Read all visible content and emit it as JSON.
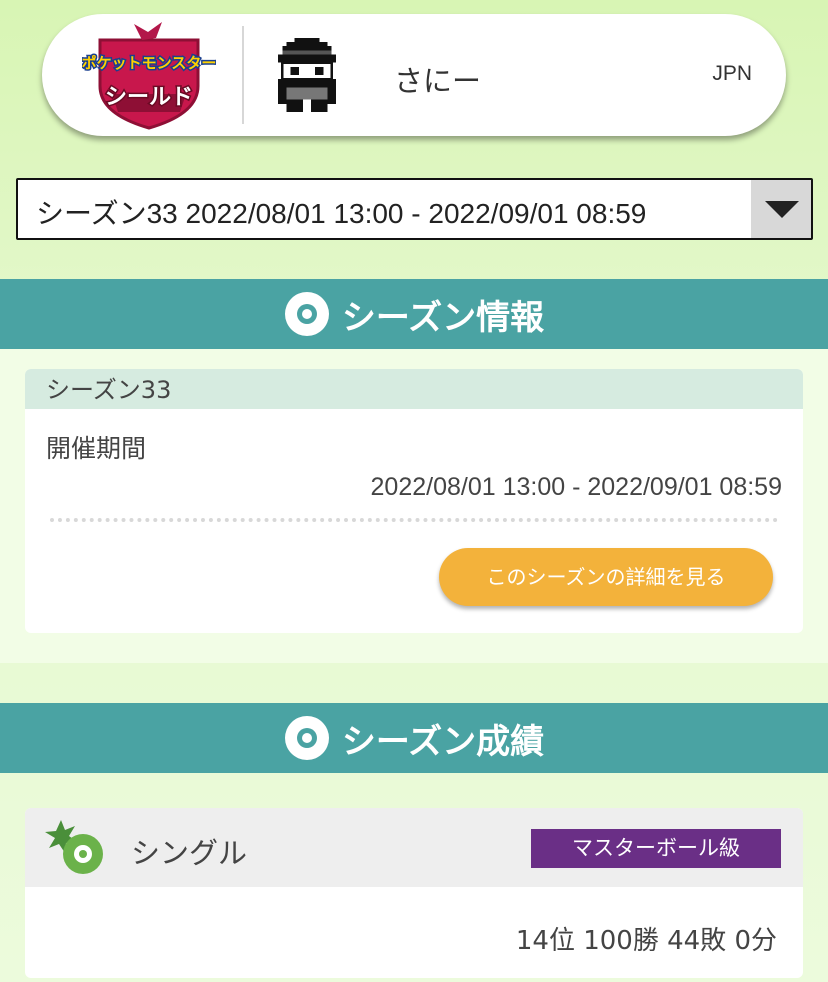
{
  "profile": {
    "game_logo_line1": "ポケットモンスター",
    "game_logo_line2": "シールド",
    "trainer_name": "さにー",
    "region": "JPN"
  },
  "season_select": {
    "selected": "シーズン33 2022/08/01 13:00 - 2022/09/01 08:59"
  },
  "season_info": {
    "header": "シーズン情報",
    "card_title": "シーズン33",
    "period_label": "開催期間",
    "period_value": "2022/08/01 13:00 - 2022/09/01 08:59",
    "detail_button": "このシーズンの詳細を見る"
  },
  "season_results": {
    "header": "シーズン成績",
    "battle_type": "シングル",
    "rank_class": "マスターボール級",
    "record": "14位 100勝 44敗 0分"
  },
  "colors": {
    "header_teal": "#4aa3a3",
    "button_orange": "#f3b23b",
    "rank_purple": "#6a2f86",
    "background_green": "#e4f8cc"
  },
  "icons": [
    "pokeball-icon",
    "select-arrow-icon",
    "single-battle-icon",
    "trainer-avatar-icon"
  ]
}
